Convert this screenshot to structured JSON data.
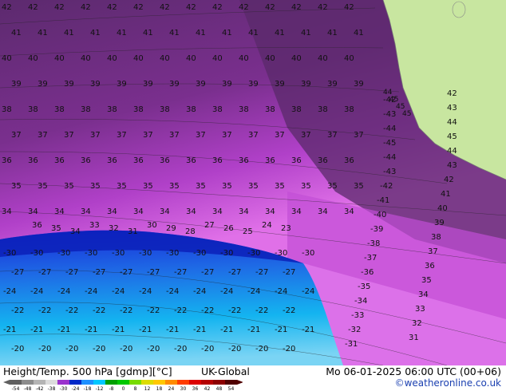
{
  "map": {
    "field_labels": {
      "upper_left_rows": [
        "42",
        "41",
        "40",
        "39",
        "38",
        "37",
        "36",
        "35",
        "34"
      ],
      "lower_rows": [
        "30",
        "27",
        "24",
        "22",
        "21",
        "20"
      ],
      "coast_labels": [
        "44",
        "45",
        "45",
        "45"
      ],
      "right_labels": [
        "42",
        "43",
        "44",
        "45",
        "44",
        "43",
        "42",
        "41",
        "40",
        "39",
        "38",
        "37",
        "36",
        "35",
        "34",
        "33",
        "32",
        "31"
      ],
      "middle_labels": [
        "36",
        "35",
        "34",
        "33",
        "32",
        "31",
        "30",
        "29",
        "28",
        "27",
        "26",
        "25",
        "24",
        "23"
      ]
    },
    "colors": {
      "land": "#c8e6a0",
      "purple_dark": "#5a2a6a",
      "purple": "#7a2f8e",
      "magenta": "#b040c8",
      "pink": "#e070e8",
      "blue_dark": "#0a2cc8",
      "blue": "#1e6ee6",
      "cyan": "#14b4f0",
      "light_cyan": "#7ad4f4"
    }
  },
  "footer": {
    "title": "Height/Temp. 500 hPa [gdmp][°C]",
    "model": "UK-Global",
    "valid": "Mo 06-01-2025 06:00 UTC (00+06)",
    "credit": "©weatheronline.co.uk",
    "scale_labels": [
      "-54",
      "-48",
      "-42",
      "-38",
      "-30",
      "-24",
      "-18",
      "-12",
      "-8",
      "0",
      "8",
      "12",
      "18",
      "24",
      "30",
      "36",
      "42",
      "48",
      "54"
    ],
    "scale_colors": [
      "#606060",
      "#8c8c8c",
      "#b4b4b4",
      "#dcdcdc",
      "#9a32cd",
      "#0028c8",
      "#1e90ff",
      "#00c8ff",
      "#00a000",
      "#00c800",
      "#78dc00",
      "#dcdc00",
      "#ffc800",
      "#ff8c00",
      "#ff3c00",
      "#dc0000",
      "#b40000",
      "#8c0000",
      "#500000"
    ]
  }
}
